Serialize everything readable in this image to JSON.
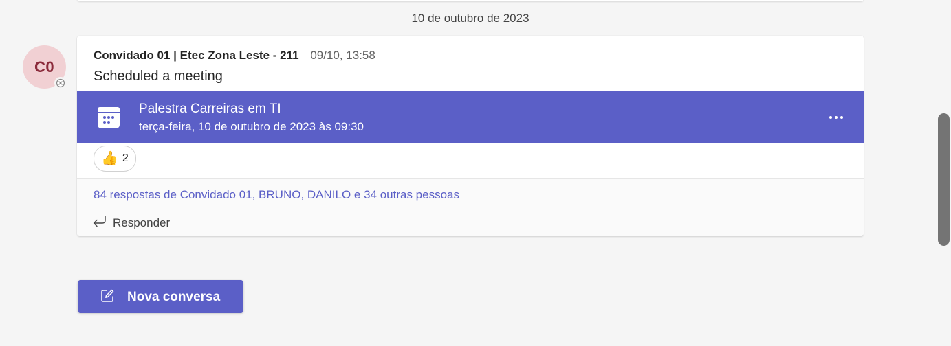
{
  "divider": {
    "date_label": "10 de outubro de 2023"
  },
  "message": {
    "avatar_initials": "C0",
    "author": "Convidado 01 | Etec Zona Leste - 211",
    "timestamp": "09/10, 13:58",
    "body": "Scheduled a meeting",
    "meeting": {
      "title": "Palestra Carreiras em TI",
      "datetime": "terça-feira, 10 de outubro de 2023 às 09:30",
      "icon": "calendar-icon",
      "more_icon": "more-options-icon"
    },
    "reaction": {
      "emoji": "👍",
      "count": "2"
    },
    "replies_summary": "84 respostas de Convidado 01, BRUNO, DANILO e 34 outras pessoas",
    "reply_label": "Responder"
  },
  "new_conversation": {
    "label": "Nova conversa",
    "icon": "compose-icon"
  },
  "colors": {
    "accent": "#5b5fc7",
    "avatar_bg": "#f1d0d3",
    "avatar_text": "#8b2b3b",
    "background": "#f5f5f5"
  }
}
